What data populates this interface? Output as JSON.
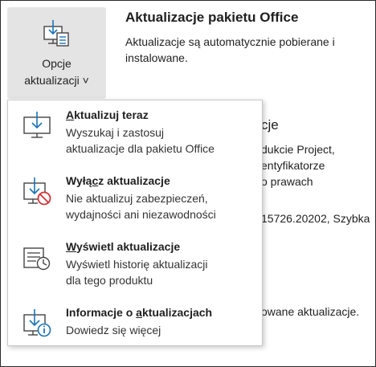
{
  "update_options": {
    "line1": "Opcje",
    "line2": "aktualizacji ˅"
  },
  "section": {
    "title": "Aktualizacje pakietu Office",
    "desc_line1": "Aktualizacje są automatycznie pobierane i",
    "desc_line2": "instalowane."
  },
  "background": {
    "heading_fragment": "cje",
    "line1": "dukcie Project,",
    "line2": "entyfikatorze",
    "line3": "o prawach",
    "line4": "15726.20202, Szybka",
    "line5": "owane aktualizacje."
  },
  "menu": [
    {
      "pre": "",
      "ul": "A",
      "post": "ktualizuj teraz",
      "d1": "Wyszukaj i zastosuj",
      "d2": "aktualizacje dla pakietu Office",
      "icon": "update-now-icon"
    },
    {
      "pre": "Wyłą",
      "ul": "c",
      "post": "z aktualizacje",
      "d1": "Nie aktualizuj zabezpieczeń,",
      "d2": "wydajności ani niezawodności",
      "icon": "disable-updates-icon"
    },
    {
      "pre": "",
      "ul": "W",
      "post": "yświetl aktualizacje",
      "d1": "Wyświetl historię aktualizacji",
      "d2": "dla tego produktu",
      "icon": "view-updates-icon"
    },
    {
      "pre": "Informacje o ",
      "ul": "a",
      "post": "ktualizacjach",
      "d1": "Dowiedz się więcej",
      "d2": "",
      "icon": "about-updates-icon"
    }
  ]
}
